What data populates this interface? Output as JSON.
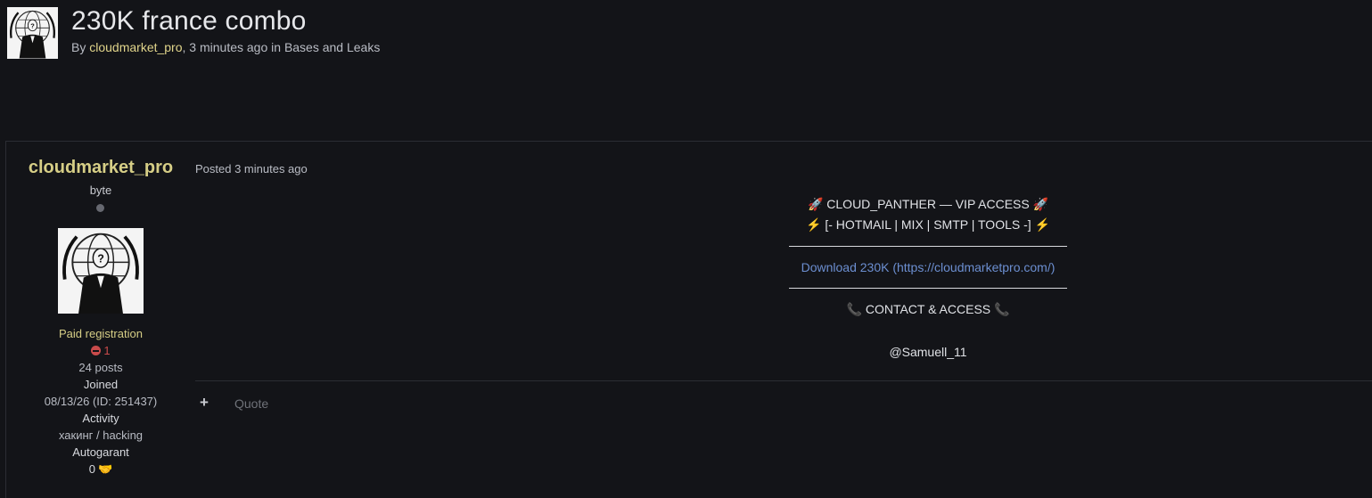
{
  "thread": {
    "title": "230K france combo",
    "by_prefix": "By ",
    "author": "cloudmarket_pro",
    "time_sep": ", ",
    "time_ago": "3 minutes ago",
    "in_prefix": " in ",
    "category": "Bases and Leaks"
  },
  "author_card": {
    "name": "cloudmarket_pro",
    "rank": "byte",
    "group": "Paid registration",
    "reputation": "1",
    "posts": "24 posts",
    "joined_label": "Joined",
    "joined_value": "08/13/26 (ID: 251437)",
    "activity_label": "Activity",
    "activity_value": "хакинг / hacking",
    "autogarant_label": "Autogarant",
    "autogarant_value": "0"
  },
  "post": {
    "posted": "Posted 3 minutes ago",
    "line1": "CLOUD_PANTHER — VIP ACCESS",
    "line2": "[- HOTMAIL | MIX | SMTP | TOOLS -]",
    "download_link": "Download 230K (https://cloudmarketpro.com/)",
    "contact": "CONTACT & ACCESS",
    "handle": "@Samuell_11"
  },
  "actions": {
    "plus": "+",
    "quote": "Quote"
  },
  "icons": {
    "rocket": "rocket-icon",
    "bolt": "lightning-icon",
    "phone": "phone-icon",
    "handshake": "handshake-icon",
    "status": "offline-dot-icon"
  },
  "colors": {
    "background": "#131418",
    "author": "#d6ce86",
    "link": "#6c8fd1",
    "reputation_negative": "#c94b4b"
  }
}
